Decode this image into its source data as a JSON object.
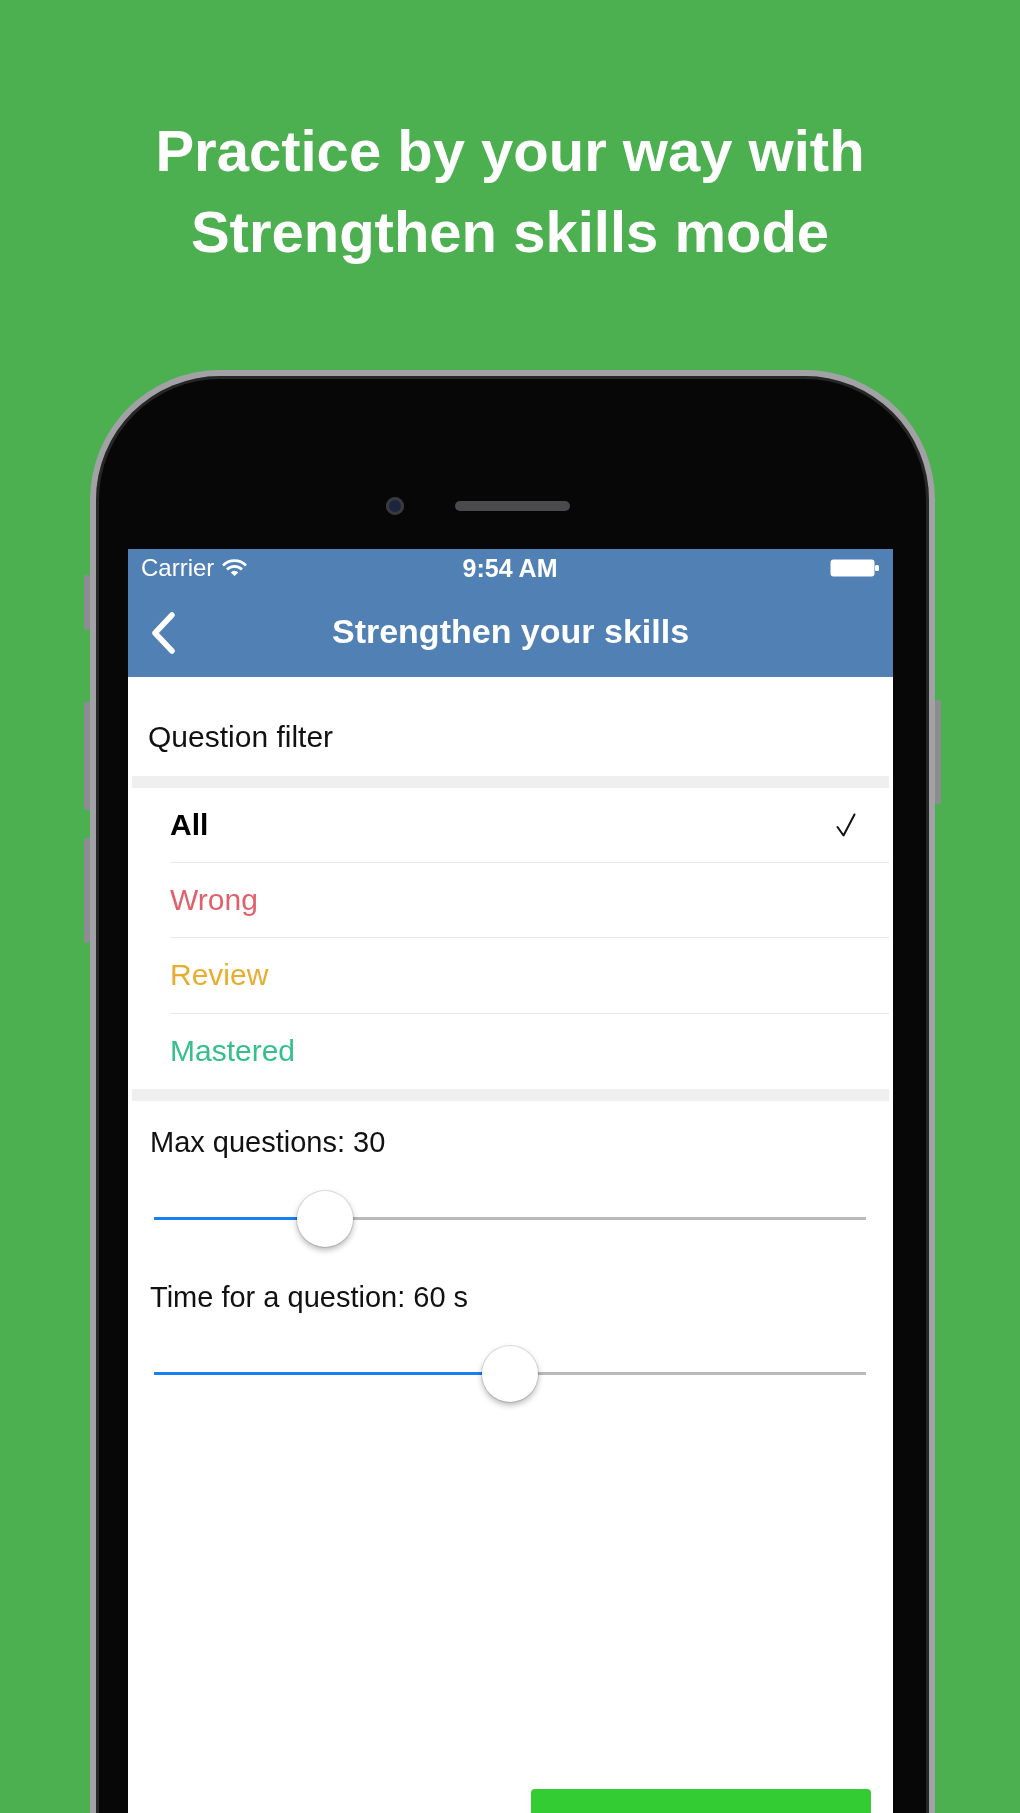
{
  "headline": "Practice by your way with Strengthen skills mode",
  "status_bar": {
    "carrier": "Carrier",
    "time": "9:54 AM"
  },
  "nav_bar": {
    "title": "Strengthen your skills"
  },
  "question_filter": {
    "title": "Question filter",
    "options": [
      {
        "label": "All",
        "selected": true,
        "color": "#000000"
      },
      {
        "label": "Wrong",
        "selected": false,
        "color": "#e0616b"
      },
      {
        "label": "Review",
        "selected": false,
        "color": "#e8ad2e"
      },
      {
        "label": "Mastered",
        "selected": false,
        "color": "#35bf8c"
      }
    ]
  },
  "sliders": [
    {
      "label": "Max questions: 30",
      "level": 0.24
    },
    {
      "label": "Time for a question: 60 s",
      "level": 0.5
    }
  ]
}
